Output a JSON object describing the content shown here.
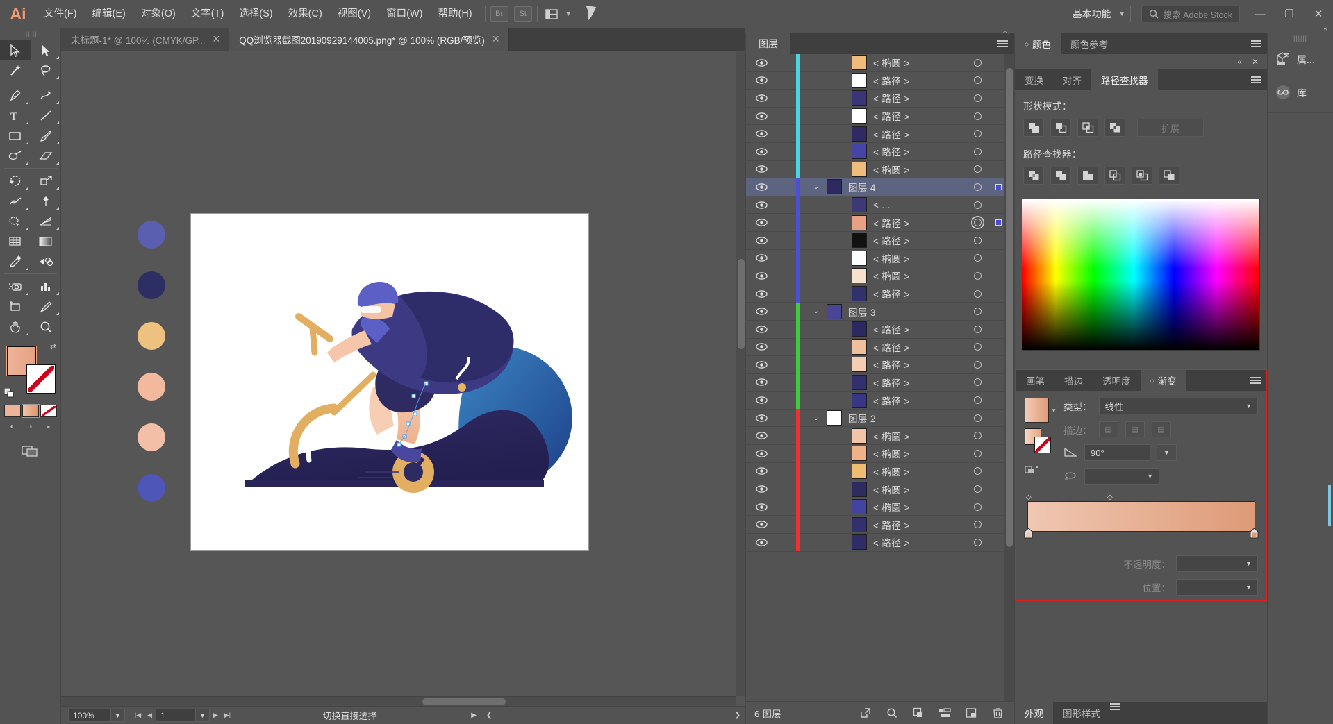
{
  "app": {
    "logo": "Ai",
    "menus": [
      "文件(F)",
      "编辑(E)",
      "对象(O)",
      "文字(T)",
      "选择(S)",
      "效果(C)",
      "视图(V)",
      "窗口(W)",
      "帮助(H)"
    ],
    "quick_buttons": [
      "Br",
      "St"
    ],
    "workspace": "基本功能",
    "search_placeholder": "搜索 Adobe Stock",
    "window_controls": {
      "minimize": "—",
      "restore": "❐",
      "close": "✕"
    }
  },
  "tabs": [
    {
      "title": "未标题-1* @ 100% (CMYK/GP...",
      "close": "✕",
      "active": false
    },
    {
      "title": "QQ浏览器截图20190929144005.png* @ 100% (RGB/预览)",
      "close": "✕",
      "active": true
    }
  ],
  "toolbar": {
    "grip": "||||||",
    "tools": [
      {
        "name": "selection-tool",
        "selected": true
      },
      {
        "name": "direct-selection-tool",
        "selected": false
      },
      {
        "name": "magic-wand-tool",
        "selected": false
      },
      {
        "name": "lasso-tool",
        "selected": false
      },
      {
        "name": "pen-tool",
        "selected": false
      },
      {
        "name": "curvature-tool",
        "selected": false
      },
      {
        "name": "type-tool",
        "selected": false
      },
      {
        "name": "line-segment-tool",
        "selected": false
      },
      {
        "name": "rectangle-tool",
        "selected": false
      },
      {
        "name": "paintbrush-tool",
        "selected": false
      },
      {
        "name": "shaper-tool",
        "selected": false
      },
      {
        "name": "eraser-tool",
        "selected": false
      },
      {
        "name": "rotate-tool",
        "selected": false
      },
      {
        "name": "scale-tool",
        "selected": false
      },
      {
        "name": "width-tool",
        "selected": false
      },
      {
        "name": "free-transform-tool",
        "selected": false
      },
      {
        "name": "shape-builder-tool",
        "selected": false
      },
      {
        "name": "perspective-grid-tool",
        "selected": false
      },
      {
        "name": "mesh-tool",
        "selected": false
      },
      {
        "name": "gradient-tool",
        "selected": false
      },
      {
        "name": "eyedropper-tool",
        "selected": false
      },
      {
        "name": "blend-tool",
        "selected": false
      },
      {
        "name": "symbol-sprayer-tool",
        "selected": false
      },
      {
        "name": "column-graph-tool",
        "selected": false
      },
      {
        "name": "artboard-tool",
        "selected": false
      },
      {
        "name": "slice-tool",
        "selected": false
      },
      {
        "name": "hand-tool",
        "selected": false
      },
      {
        "name": "zoom-tool",
        "selected": false
      }
    ],
    "fill_color": "#eeb499",
    "stroke_color": "#ffffff",
    "stroke_none": true
  },
  "canvas": {
    "artboard_bg": "#ffffff",
    "palette_dots": [
      "#5b5fb0",
      "#2d2f63",
      "#efc181",
      "#f2b99e",
      "#f3c0a7",
      "#4e56b8"
    ],
    "illustration": {
      "navy": "#2d2a5e",
      "periwinkle": "#5b5fc7",
      "skin": "#f5c2a6",
      "gold": "#e8b45f",
      "blue": "#2e6fb0",
      "deep": "#262154"
    }
  },
  "status": {
    "zoom": "100%",
    "page": "1",
    "message": "切换直接选择",
    "nav_first": "|◀",
    "nav_prev": "◀",
    "nav_next": "▶",
    "nav_last": "▶|"
  },
  "layers_panel": {
    "tab": "图层",
    "footer_count": "6 图层",
    "footer_icons": [
      "locate-object-icon",
      "make-clipping-mask-icon",
      "create-new-sublayer-icon",
      "create-new-layer-icon",
      "delete-selection-icon"
    ],
    "rows": [
      {
        "name": "< 椭圆 >",
        "type": "item",
        "color": "#4ad6e0",
        "thumb": "#f0bc7b",
        "indent": 3,
        "selected": false,
        "target": "single"
      },
      {
        "name": "< 路径 >",
        "type": "item",
        "color": "#4ad6e0",
        "thumb": "#ffffff",
        "indent": 3,
        "selected": false,
        "target": "single"
      },
      {
        "name": "< 路径 >",
        "type": "item",
        "color": "#4ad6e0",
        "thumb": "#3b3477",
        "indent": 3,
        "selected": false,
        "target": "single"
      },
      {
        "name": "< 路径 >",
        "type": "item",
        "color": "#4ad6e0",
        "thumb": "#ffffff",
        "indent": 3,
        "selected": false,
        "target": "single"
      },
      {
        "name": "< 路径 >",
        "type": "item",
        "color": "#4ad6e0",
        "thumb": "#2f2a63",
        "indent": 3,
        "selected": false,
        "target": "single"
      },
      {
        "name": "< 路径 >",
        "type": "item",
        "color": "#4ad6e0",
        "thumb": "#4545a8",
        "indent": 3,
        "selected": false,
        "target": "single"
      },
      {
        "name": "< 椭圆 >",
        "type": "item",
        "color": "#4ad6e0",
        "thumb": "#f0bc7b",
        "indent": 3,
        "selected": false,
        "target": "single"
      },
      {
        "name": "图层 4",
        "type": "layer",
        "color": "#4a50d8",
        "thumb": "#2d2a5e",
        "indent": 0,
        "selected": true,
        "target": "single",
        "has_select_square": true
      },
      {
        "name": "< ...",
        "type": "item",
        "color": "#4a50d8",
        "thumb": "#3c3a76",
        "indent": 3,
        "selected": false,
        "target": "single"
      },
      {
        "name": "< 路径 >",
        "type": "item",
        "color": "#4a50d8",
        "thumb": "#e8a184",
        "indent": 3,
        "selected": false,
        "target": "double",
        "has_select_square": true
      },
      {
        "name": "< 路径 >",
        "type": "item",
        "color": "#4a50d8",
        "thumb": "#111111",
        "indent": 3,
        "selected": false,
        "target": "single"
      },
      {
        "name": "< 椭圆 >",
        "type": "item",
        "color": "#4a50d8",
        "thumb": "#fdfdfd",
        "indent": 3,
        "selected": false,
        "target": "single"
      },
      {
        "name": "< 椭圆 >",
        "type": "item",
        "color": "#4a50d8",
        "thumb": "#f7e2cd",
        "indent": 3,
        "selected": false,
        "target": "single"
      },
      {
        "name": "< 路径 >",
        "type": "item",
        "color": "#4a50d8",
        "thumb": "#33306e",
        "indent": 3,
        "selected": false,
        "target": "single"
      },
      {
        "name": "图层 3",
        "type": "layer",
        "color": "#3ecb3e",
        "thumb": "#4a4596",
        "indent": 0,
        "selected": false,
        "target": "single"
      },
      {
        "name": "< 路径 >",
        "type": "item",
        "color": "#3ecb3e",
        "thumb": "#2b2862",
        "indent": 3,
        "selected": false,
        "target": "single"
      },
      {
        "name": "< 路径 >",
        "type": "item",
        "color": "#3ecb3e",
        "thumb": "#f0c09c",
        "indent": 3,
        "selected": false,
        "target": "single"
      },
      {
        "name": "< 路径 >",
        "type": "item",
        "color": "#3ecb3e",
        "thumb": "#f3cdb4",
        "indent": 3,
        "selected": false,
        "target": "single"
      },
      {
        "name": "< 路径 >",
        "type": "item",
        "color": "#3ecb3e",
        "thumb": "#32306f",
        "indent": 3,
        "selected": false,
        "target": "single"
      },
      {
        "name": "< 路径 >",
        "type": "item",
        "color": "#3ecb3e",
        "thumb": "#3a3686",
        "indent": 3,
        "selected": false,
        "target": "single"
      },
      {
        "name": "图层 2",
        "type": "layer",
        "color": "#f03030",
        "thumb": "#ffffff",
        "indent": 0,
        "selected": false,
        "target": "single"
      },
      {
        "name": "< 椭圆 >",
        "type": "item",
        "color": "#f03030",
        "thumb": "#f2c5a8",
        "indent": 3,
        "selected": false,
        "target": "single"
      },
      {
        "name": "< 椭圆 >",
        "type": "item",
        "color": "#f03030",
        "thumb": "#efb185",
        "indent": 3,
        "selected": false,
        "target": "single"
      },
      {
        "name": "< 椭圆 >",
        "type": "item",
        "color": "#f03030",
        "thumb": "#eebd72",
        "indent": 3,
        "selected": false,
        "target": "single"
      },
      {
        "name": "< 椭圆 >",
        "type": "item",
        "color": "#f03030",
        "thumb": "#2e2b5f",
        "indent": 3,
        "selected": false,
        "target": "single"
      },
      {
        "name": "< 椭圆 >",
        "type": "item",
        "color": "#f03030",
        "thumb": "#4343a0",
        "indent": 3,
        "selected": false,
        "target": "single"
      },
      {
        "name": "< 路径 >",
        "type": "item",
        "color": "#f03030",
        "thumb": "#33306e",
        "indent": 3,
        "selected": false,
        "target": "single"
      },
      {
        "name": "< 路径 >",
        "type": "item",
        "color": "#f03030",
        "thumb": "#2f2c66",
        "indent": 3,
        "selected": false,
        "target": "single"
      }
    ]
  },
  "color_panel": {
    "tabs": [
      {
        "label": "颜色",
        "active": true,
        "diamond": true
      },
      {
        "label": "颜色参考",
        "active": false,
        "diamond": false
      }
    ]
  },
  "pathfinder_panel": {
    "tabs": [
      {
        "label": "变换",
        "active": false
      },
      {
        "label": "对齐",
        "active": false
      },
      {
        "label": "路径查找器",
        "active": true
      }
    ],
    "shape_modes_label": "形状模式：",
    "pathfinder_label": "路径查找器：",
    "expand_button": "扩展",
    "shape_mode_buttons": [
      "unite-icon",
      "minus-front-icon",
      "intersect-icon",
      "exclude-icon"
    ],
    "pathfinder_buttons": [
      "divide-icon",
      "trim-icon",
      "merge-icon",
      "crop-icon",
      "outline-icon",
      "minus-back-icon"
    ],
    "collapse": "«",
    "close": "✕"
  },
  "gradient_panel": {
    "tabs": [
      {
        "label": "画笔",
        "active": false,
        "diamond": false
      },
      {
        "label": "描边",
        "active": false,
        "diamond": false
      },
      {
        "label": "透明度",
        "active": false,
        "diamond": false
      },
      {
        "label": "渐变",
        "active": true,
        "diamond": true
      }
    ],
    "type_label": "类型：",
    "type_value": "线性",
    "stroke_label": "描边：",
    "angle_label": "angle-icon",
    "angle_value": "90°",
    "aspect_label": "aspect-ratio-icon",
    "opacity_label": "不透明度：",
    "position_label": "位置：",
    "gradient_start": "#f0c7b2",
    "gradient_end": "#dd9a77",
    "highlight_border": "#e02020"
  },
  "appearance_panel": {
    "tabs": [
      {
        "label": "外观",
        "active": true
      },
      {
        "label": "图形样式",
        "active": false
      }
    ]
  },
  "dock": {
    "items": [
      {
        "label": "属...",
        "icon": "properties-icon"
      },
      {
        "label": "库",
        "icon": "libraries-icon"
      }
    ],
    "collapse": "«"
  }
}
